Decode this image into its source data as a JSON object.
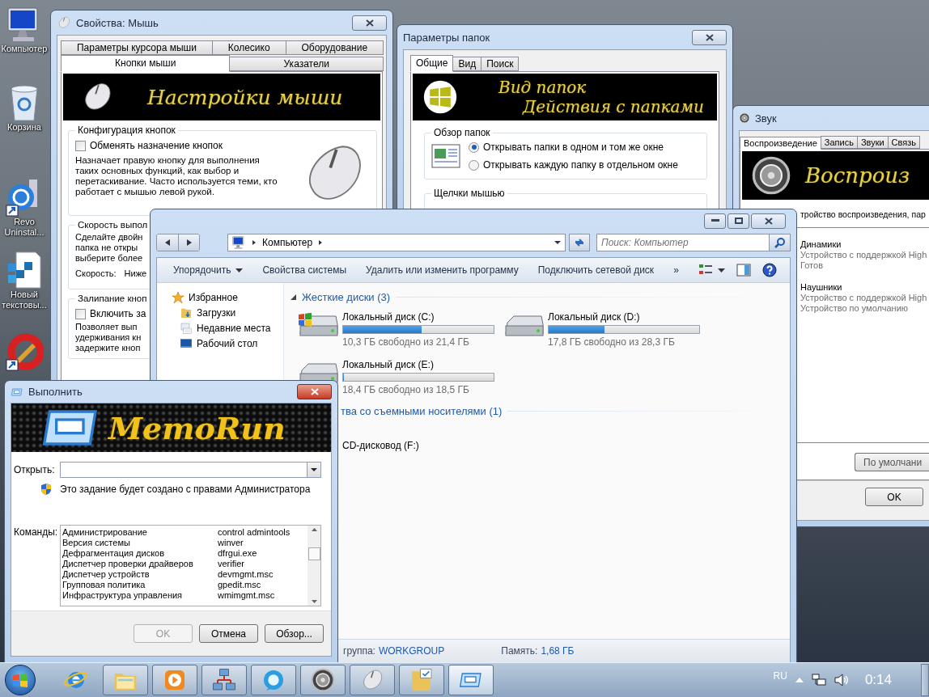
{
  "desktop_icons": [
    {
      "kind": "computer",
      "label": "Компьютер"
    },
    {
      "kind": "recycle_bin",
      "label": "Корзина"
    },
    {
      "kind": "uninstaller",
      "label": "Revo Uninstal..."
    },
    {
      "kind": "text_file",
      "label": "Новый текстовы..."
    },
    {
      "kind": "cleaner"
    }
  ],
  "mouse_window": {
    "title": "Свойства: Мышь",
    "tab_rows": [
      {
        "tabs": [
          {
            "label": "Параметры курсора мыши",
            "selected": false
          },
          {
            "label": "Колесико",
            "selected": false
          },
          {
            "label": "Оборудование",
            "selected": false
          }
        ]
      },
      {
        "tabs": [
          {
            "label": "Кнопки мыши",
            "selected": true
          },
          {
            "label": "Указатели",
            "selected": false
          }
        ]
      }
    ],
    "banner_text": "Настройки мыши",
    "groups": [
      {
        "title": "Конфигурация кнопок",
        "checkbox": {
          "label": "Обменять назначение кнопок",
          "checked": false
        },
        "description": "Назначает правую кнопку для выполнения таких основных функций, как выбор и перетаскивание. Часто используется теми, кто работает с мышью левой рукой."
      },
      {
        "title": "Скорость выпол",
        "lines": [
          "Сделайте двойн",
          "папка не откры",
          "выберите более"
        ],
        "speed_label": "Скорость:",
        "speed_value": "Ниже"
      },
      {
        "title": "Залипание кноп",
        "checkbox": {
          "label": "Включить за",
          "checked": false
        },
        "lines": [
          "Позволяет вып",
          "удерживания кн",
          "задержите кноп"
        ]
      }
    ]
  },
  "folder_window": {
    "title": "Параметры папок",
    "tabs": [
      {
        "label": "Общие",
        "selected": true
      },
      {
        "label": "Вид",
        "selected": false
      },
      {
        "label": "Поиск",
        "selected": false
      }
    ],
    "banner_lines": [
      "Вид папок",
      "Действия с папками"
    ],
    "browse_group": {
      "title": "Обзор папок",
      "options": [
        {
          "label": "Открывать папки в одном и том же окне",
          "selected": true
        },
        {
          "label": "Открывать каждую папку в отдельном окне",
          "selected": false
        }
      ]
    },
    "click_group": {
      "title": "Щелчки мышью"
    }
  },
  "sound_window": {
    "title": "Звук",
    "tabs": [
      {
        "label": "Воспроизведение",
        "selected": true
      },
      {
        "label": "Запись",
        "selected": false
      },
      {
        "label": "Звуки",
        "selected": false
      },
      {
        "label": "Связь",
        "selected": false
      }
    ],
    "banner_text": "Воспроиз",
    "hint": "тройство воспроизведения, пар",
    "devices": [
      {
        "name": "Динамики",
        "description": "Устройство с поддержкой High",
        "status": "Готов"
      },
      {
        "name": "Наушники",
        "description": "Устройство с поддержкой High",
        "status": "Устройство по умолчанию"
      }
    ],
    "default_button": "По умолчани",
    "ok_button": "OK"
  },
  "explorer": {
    "address": "Компьютер",
    "search_placeholder": "Поиск: Компьютер",
    "toolbar": [
      {
        "label": "Упорядочить",
        "kind": "menu"
      },
      {
        "label": "Свойства системы",
        "kind": "plain"
      },
      {
        "label": "Удалить или изменить программу",
        "kind": "plain"
      },
      {
        "label": "Подключить сетевой диск",
        "kind": "plain"
      },
      {
        "label": "»",
        "kind": "more"
      }
    ],
    "favorites": {
      "label": "Избранное",
      "items": [
        {
          "label": "Загрузки",
          "kind": "downloads"
        },
        {
          "label": "Недавние места",
          "kind": "recent"
        },
        {
          "label": "Рабочий стол",
          "kind": "desktop"
        }
      ]
    },
    "hard_disks": {
      "title": "Жесткие диски (3)",
      "drives": [
        {
          "name": "Локальный диск (C:)",
          "free": "10,3 ГБ свободно из 21,4 ГБ",
          "level": 0.52,
          "system": true
        },
        {
          "name": "Локальный диск (D:)",
          "free": "17,8 ГБ свободно из 28,3 ГБ",
          "level": 0.37,
          "system": false
        },
        {
          "name": "Локальный диск (E:)",
          "free": "18,4 ГБ свободно из 18,5 ГБ",
          "level": 0.005,
          "system": false
        }
      ]
    },
    "removable": {
      "title": "тва со съемными носителями (1)",
      "drives": [
        {
          "name": "CD-дисковод (F:)"
        }
      ]
    },
    "status": {
      "workgroup_label": "группа:",
      "workgroup": "WORKGROUP",
      "memory_label": "Память:",
      "memory": "1,68 ГБ"
    }
  },
  "run_window": {
    "title": "Выполнить",
    "banner_text": "MemoRun",
    "open_label": "Открыть:",
    "admin_note": "Это задание будет создано с правами Администратора",
    "commands_label": "Команды:",
    "commands": [
      {
        "name": "Администрирование",
        "command": "control admintools"
      },
      {
        "name": "Версия системы",
        "command": "winver"
      },
      {
        "name": "Дефрагментация дисков",
        "command": "dfrgui.exe"
      },
      {
        "name": "Диспетчер проверки драйверов",
        "command": "verifier"
      },
      {
        "name": "Диспетчер устройств",
        "command": "devmgmt.msc"
      },
      {
        "name": "Групповая политика",
        "command": "gpedit.msc"
      },
      {
        "name": "Инфраструктура управления",
        "command": "wmimgmt.msc"
      }
    ],
    "buttons": [
      {
        "label": "OK",
        "disabled": true
      },
      {
        "label": "Отмена",
        "disabled": false
      },
      {
        "label": "Обзор...",
        "disabled": false
      }
    ]
  },
  "taskbar": {
    "items": [
      {
        "kind": "browser",
        "running": false,
        "selected": false
      },
      {
        "kind": "explorer",
        "running": true,
        "selected": false
      },
      {
        "kind": "media_player",
        "running": true,
        "selected": false
      },
      {
        "kind": "network",
        "running": true,
        "selected": false
      },
      {
        "kind": "messenger",
        "running": true,
        "selected": false
      },
      {
        "kind": "speaker",
        "running": true,
        "selected": false
      },
      {
        "kind": "mouse",
        "running": true,
        "selected": false
      },
      {
        "kind": "folder_options",
        "running": true,
        "selected": false
      },
      {
        "kind": "run",
        "running": true,
        "selected": true
      }
    ],
    "language": "RU",
    "clock": "0:14"
  }
}
